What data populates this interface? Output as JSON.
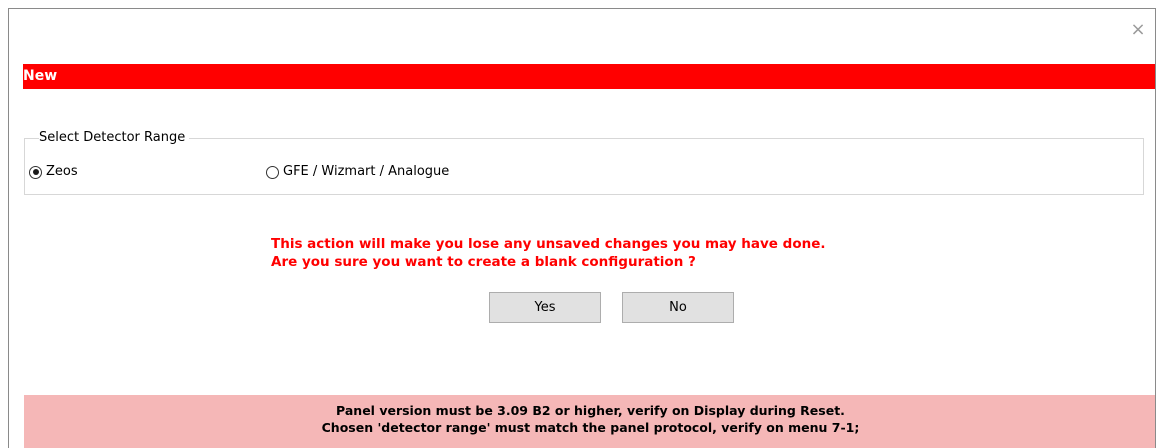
{
  "window": {
    "close_glyph": "×",
    "title": "New"
  },
  "detector_range": {
    "group_label": "Select Detector Range",
    "options": [
      {
        "label": "Zeos",
        "selected": true
      },
      {
        "label": "GFE / Wizmart / Analogue",
        "selected": false
      }
    ]
  },
  "warning": {
    "line1": "This action will make you lose any unsaved changes you may have done.",
    "line2": "Are you sure you want to create a blank configuration ?"
  },
  "buttons": {
    "yes_label": "Yes",
    "no_label": "No"
  },
  "info": {
    "line1": "Panel version must be 3.09 B2 or higher, verify on Display during Reset.",
    "line2": "Chosen 'detector range' must match the panel protocol, verify on menu 7-1;"
  },
  "colors": {
    "title_bar": "#ff0000",
    "warning_text": "#ff0000",
    "info_bar": "#f5b7b7",
    "button_face": "#e1e1e1"
  }
}
